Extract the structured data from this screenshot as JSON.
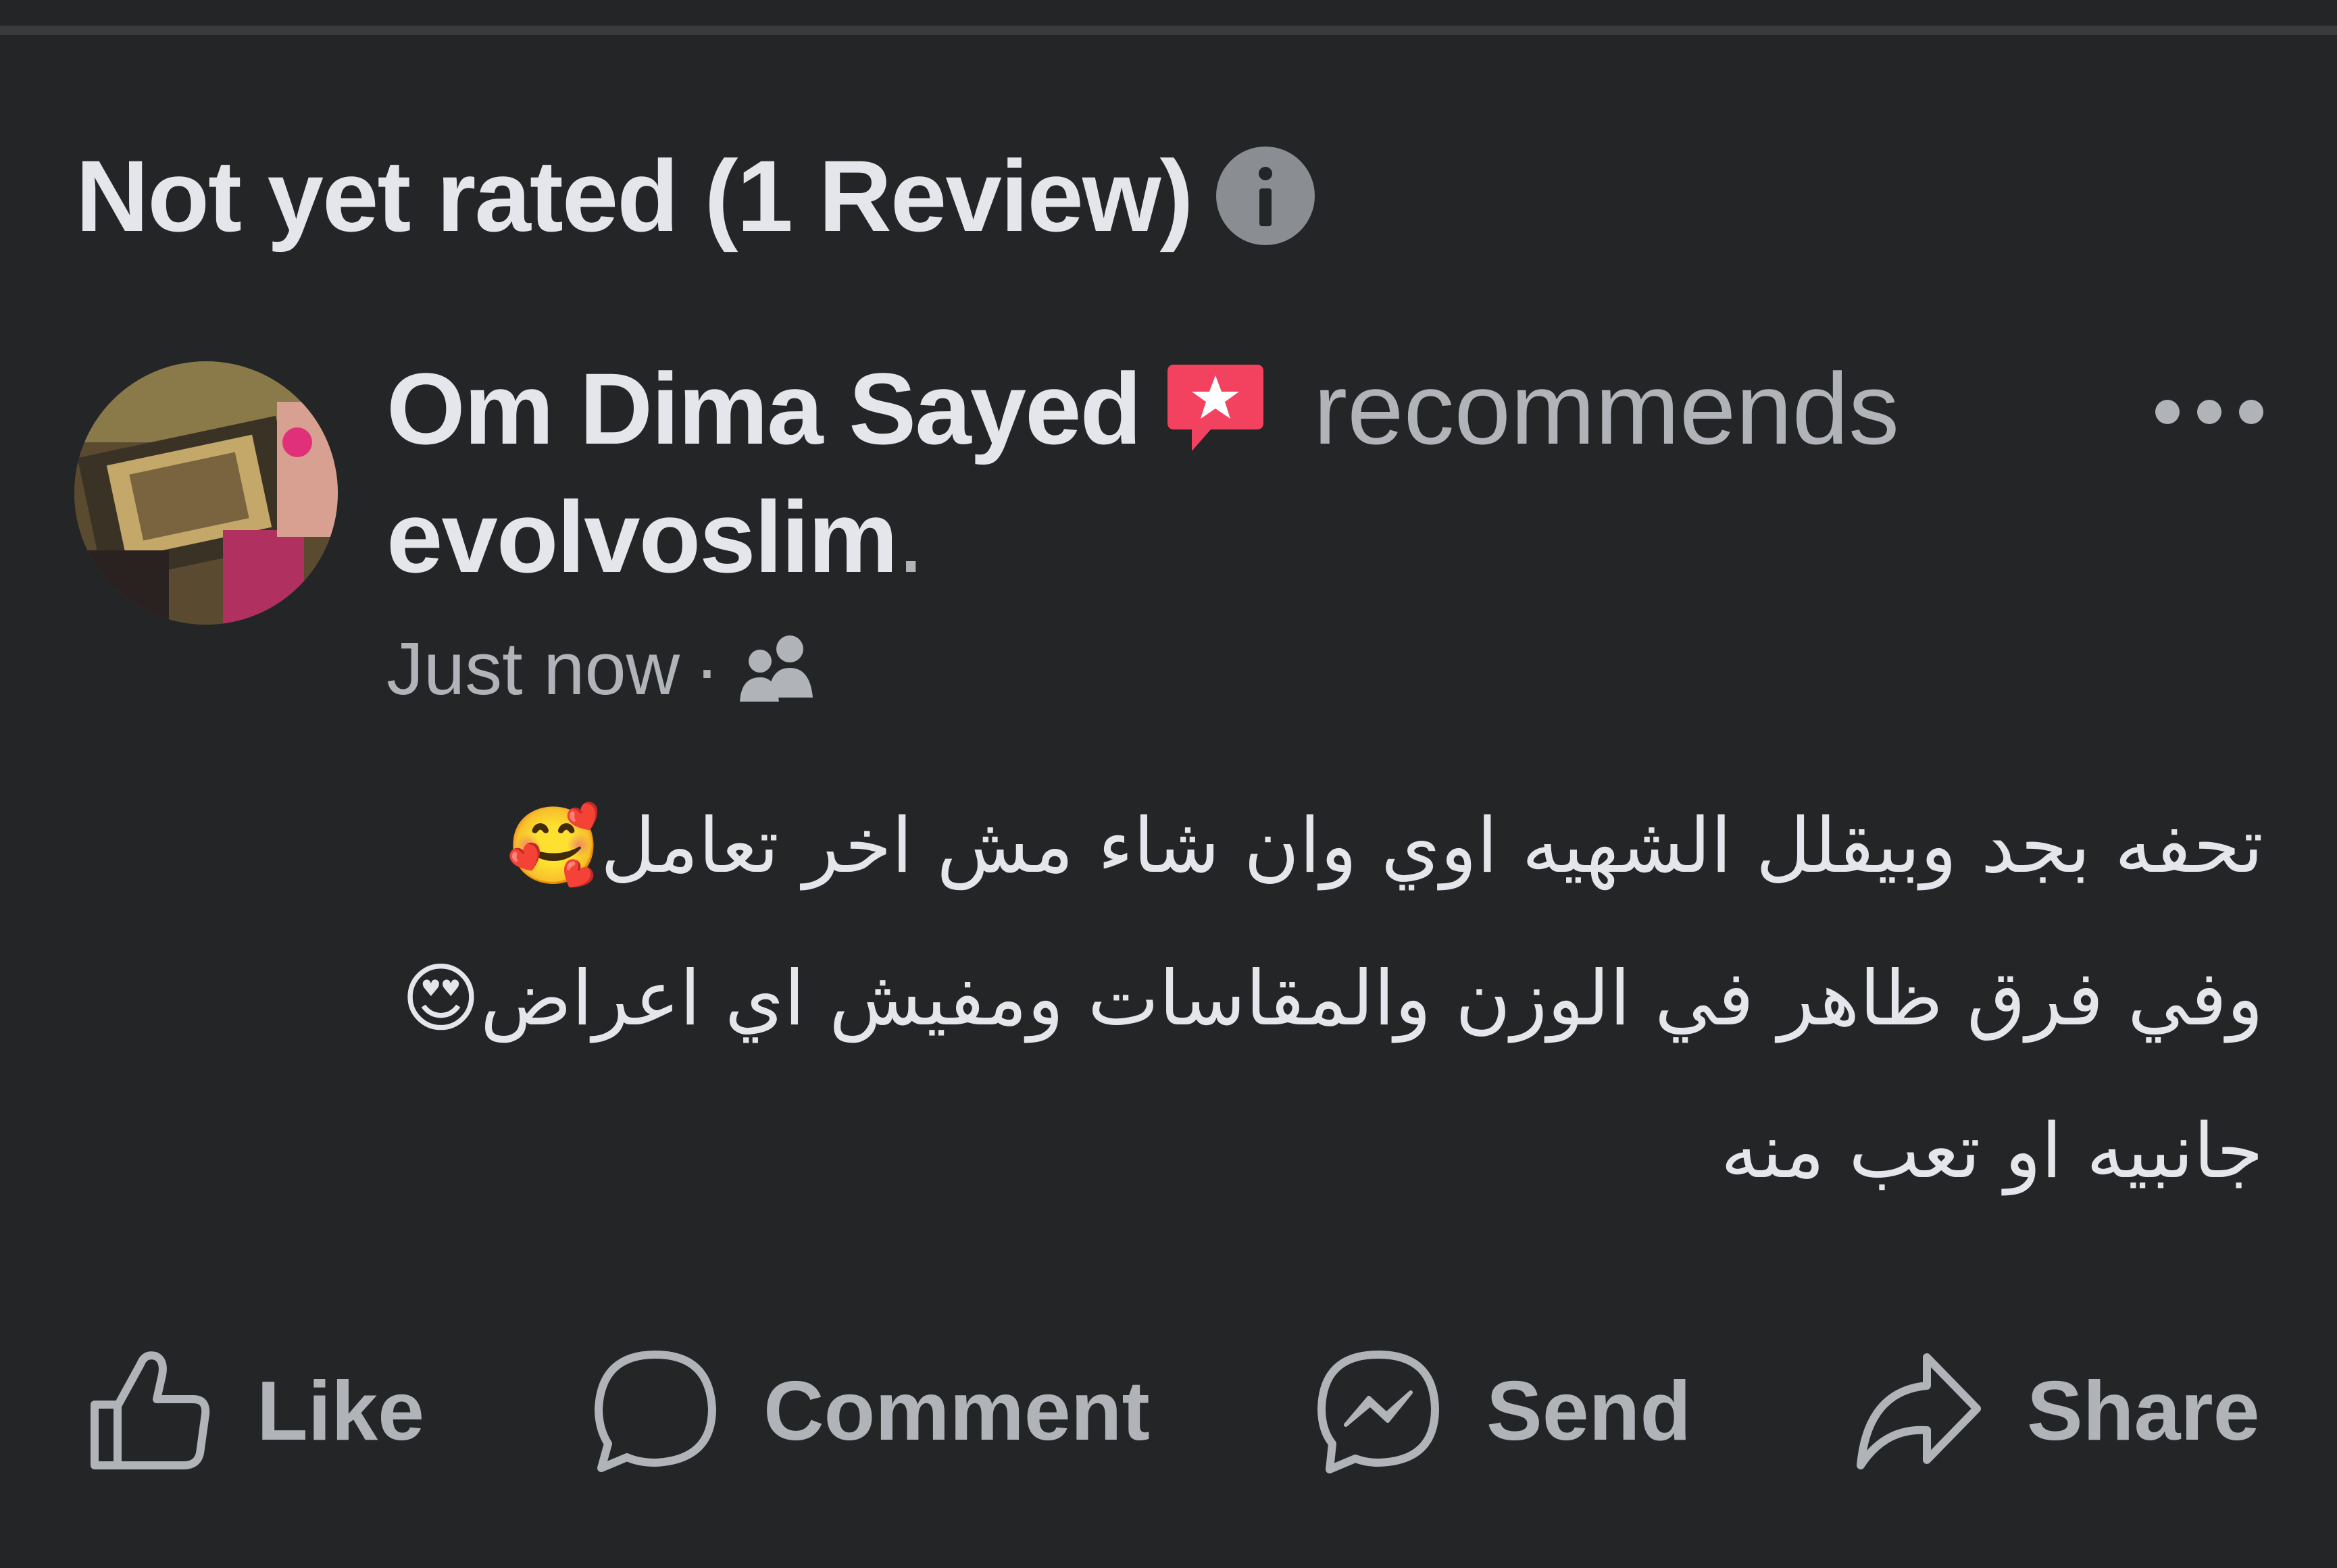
{
  "rating": {
    "title": "Not yet rated (1 Review)",
    "info_icon": "info-icon"
  },
  "post": {
    "author": "Om Dima Sayed",
    "badge_icon": "recommendation-badge-icon",
    "action_text": "recommends",
    "page_name": "evolvoslim",
    "period": ".",
    "timestamp": "Just now",
    "separator": "·",
    "audience_icon": "friends-icon",
    "more_icon": "more-options-icon",
    "body_lines": [
      "تحفه بجد وبيقلل الشهيه اوي  وان شاء مش اخر تعامل🥰",
      "وفي فرق ظاهر في الوزن والمقاسات ومفيش اي اعراض😍",
      "جانبيه او تعب منه"
    ]
  },
  "actions": {
    "like": "Like",
    "comment": "Comment",
    "send": "Send",
    "share": "Share"
  },
  "colors": {
    "background": "#242526",
    "primary_text": "#e4e6eb",
    "secondary_text": "#b0b3b8",
    "badge": "#f3425f"
  }
}
